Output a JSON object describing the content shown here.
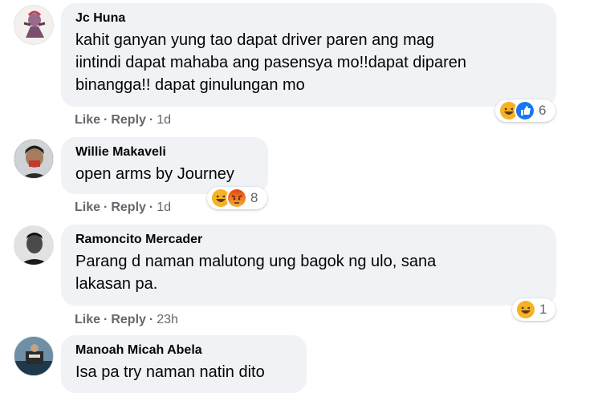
{
  "actions": {
    "like": "Like",
    "reply": "Reply",
    "separator": "·"
  },
  "comments": [
    {
      "author": "Jc Huna",
      "text": "kahit ganyan yung tao dapat driver paren ang mag\niintindi dapat mahaba ang pasensya mo!!dapat diparen\nbinangga!! dapat ginulungan mo",
      "time": "1d",
      "reactions": [
        "haha",
        "like"
      ],
      "reaction_count": "6"
    },
    {
      "author": "Willie Makaveli",
      "text": "open arms by Journey",
      "time": "1d",
      "reactions": [
        "haha",
        "angry"
      ],
      "reaction_count": "8"
    },
    {
      "author": "Ramoncito Mercader",
      "text": "Parang d naman malutong ung bagok ng ulo, sana\nlakasan pa.",
      "time": "23h",
      "reactions": [
        "haha"
      ],
      "reaction_count": "1"
    },
    {
      "author": "Manoah Micah Abela",
      "text": "Isa pa try naman natin dito"
    }
  ],
  "colors": {
    "bubble": "#f0f2f5",
    "name": "#050505",
    "meta": "#65676b",
    "like_blue": "#1877f2",
    "haha_yellow": "#f7b125",
    "angry_red": "#e9710f"
  }
}
